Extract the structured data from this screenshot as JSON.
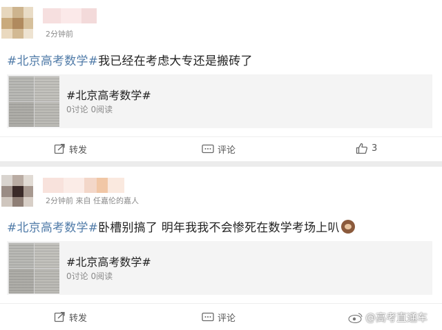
{
  "posts": [
    {
      "meta": "2分钟前",
      "text_hashtag": "#北京高考数学#",
      "text_body": "我已经在考虑大专还是搬砖了",
      "emoji": "",
      "topic": {
        "title": "#北京高考数学#",
        "stats": "0讨论 0阅读"
      },
      "actions": {
        "repost": "转发",
        "comment": "评论",
        "like": "3"
      }
    },
    {
      "meta": "2分钟前 来自 任嘉伦的嘉人",
      "text_hashtag": "#北京高考数学#",
      "text_body": "卧槽别搞了 明年我我不会惨死在数学考场上叭",
      "emoji": "monkey-covering-eyes",
      "topic": {
        "title": "#北京高考数学#",
        "stats": "0讨论 0阅读"
      },
      "actions": {
        "repost": "转发",
        "comment": "评论"
      }
    }
  ],
  "watermark": {
    "text": "@高考直通车"
  },
  "colors": {
    "hashtag": "#507ba8",
    "meta": "#8a8a8a",
    "background": "#ececec"
  }
}
